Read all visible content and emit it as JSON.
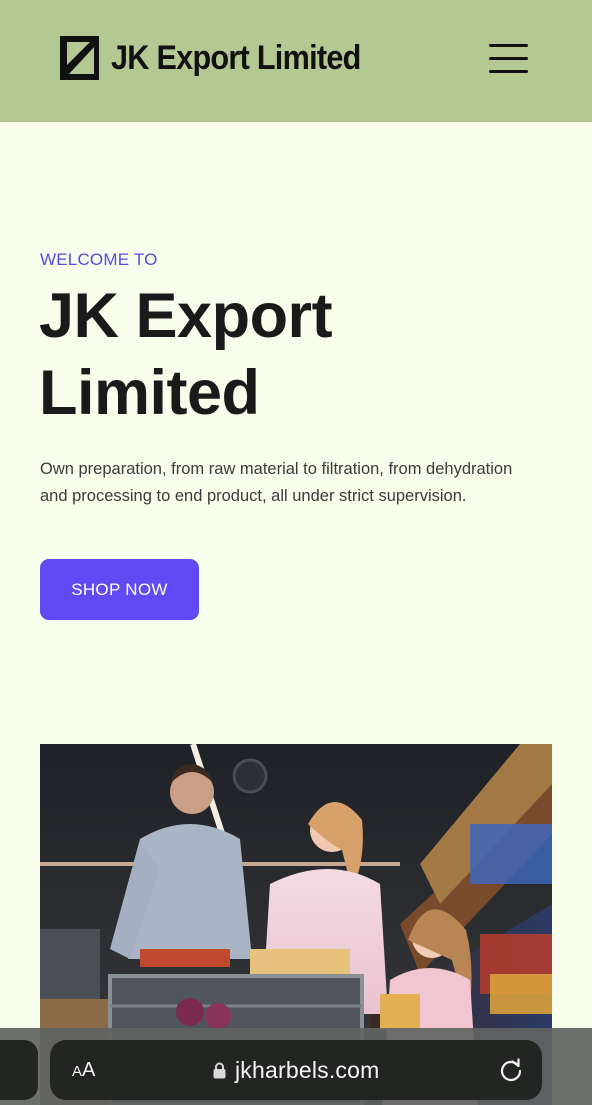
{
  "header": {
    "brand": "JK Export Limited"
  },
  "hero": {
    "eyebrow": "WELCOME TO",
    "title": "JK Export Limited",
    "description": "Own preparation, from raw material to filtration, from dehydration and processing to end product, all under strict supervision.",
    "cta_label": "SHOP NOW"
  },
  "browser": {
    "text_size_label_small": "A",
    "text_size_label_large": "A",
    "url": "jkharbels.com"
  },
  "colors": {
    "header_bg": "#b3c893",
    "page_bg": "#f9fdeb",
    "accent": "#6149f3",
    "eyebrow": "#5b47e6"
  },
  "icons": {
    "logo": "square-corner-logo-icon",
    "menu": "hamburger-menu-icon",
    "lock": "lock-icon",
    "reload": "reload-icon"
  }
}
